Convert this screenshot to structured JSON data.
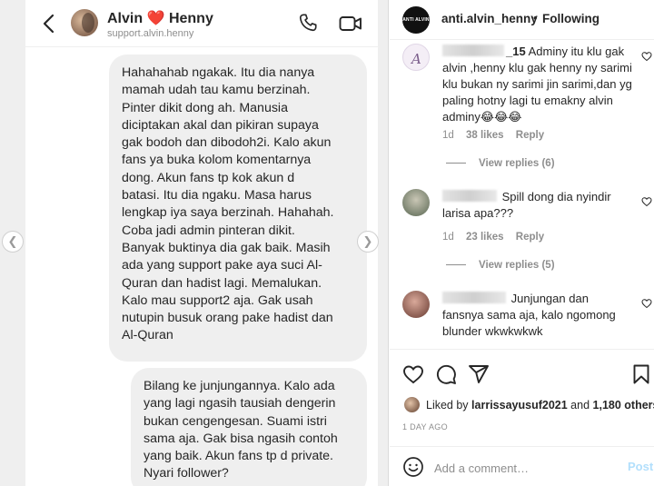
{
  "chat": {
    "name": "Alvin",
    "heart": "❤️",
    "name2": "Henny",
    "handle": "support.alvin.henny",
    "messages": [
      "Hahahahab ngakak. Itu dia nanya\nmamah udah tau kamu berzinah.\nPinter dikit dong ah. Manusia\ndiciptakan akal dan pikiran supaya\ngak bodoh dan dibodoh2i. Kalo akun\nfans ya buka kolom komentarnya\ndong. Akun fans tp kok akun d\nbatasi. Itu dia ngaku. Masa harus\nlengkap iya saya berzinah. Hahahah.\nCoba jadi admin pinteran dikit.\nBanyak buktinya dia gak baik. Masih\nada yang support pake aya suci Al-\nQuran dan hadist lagi. Memalukan.\nKalo mau support2 aja. Gak usah\nnutupin busuk orang pake hadist dan\nAl-Quran",
      "Bilang ke junjungannya. Kalo ada\nyang lagi ngasih tausiah dengerin\nbukan cengengesan. Suami istri\nsama aja. Gak bisa ngasih contoh\nyang baik. Akun fans tp d private.\nNyari follower?"
    ]
  },
  "post": {
    "username": "anti.alvin_henny",
    "avatar_text": "ANTI ALVIN HENNY",
    "dot": "•",
    "following": "Following"
  },
  "comments": [
    {
      "user_suffix": "_15",
      "text": "Adminy itu klu gak alvin ,henny klu gak henny ny sarimi klu bukan ny sarimi jin sarimi,dan yg paling hotny lagi tu emakny alvin adminy😂😂😂",
      "time": "1d",
      "likes": "38 likes",
      "reply": "Reply",
      "view_replies": "View replies (6)"
    },
    {
      "user_suffix": "",
      "text": "Spill dong dia nyindir larisa apa???",
      "time": "1d",
      "likes": "23 likes",
      "reply": "Reply",
      "view_replies": "View replies (5)"
    },
    {
      "user_suffix": "",
      "text": "Junjungan dan fansnya sama aja, kalo ngomong blunder wkwkwkwk"
    }
  ],
  "likes": {
    "prefix": "Liked by",
    "user": "larrissayusuf2021",
    "middle": "and",
    "others": "1,180 others"
  },
  "date": "1 DAY AGO",
  "add_comment": {
    "placeholder": "Add a comment…",
    "post_label": "Post"
  },
  "colors": {
    "heart": "#e0245e",
    "post_button_disabled": "#b2dffc",
    "bubble": "#efefef",
    "secondary_text": "#8e8e8e"
  },
  "icons": [
    "back-arrow-icon",
    "phone-icon",
    "video-camera-icon",
    "heart-icon",
    "comment-icon",
    "share-icon",
    "bookmark-icon",
    "emoji-icon",
    "chevron-left-icon",
    "chevron-right-icon"
  ]
}
